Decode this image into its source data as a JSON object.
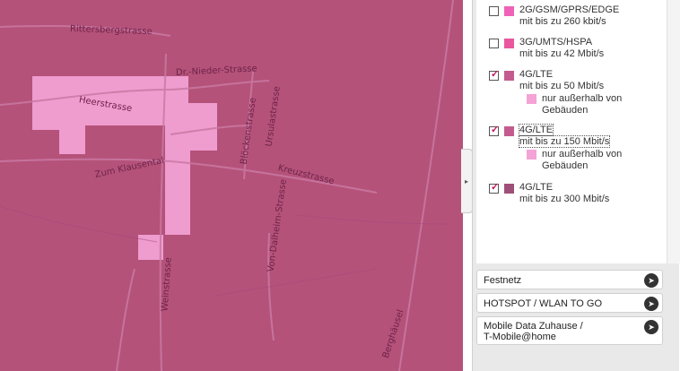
{
  "map": {
    "streets": [
      "Rittersbergstrasse",
      "Dr.-Nieder-Strasse",
      "Heerstrasse",
      "Zum Klausental",
      "Blöckenstrasse",
      "Ursulastrasse",
      "Kreuzstrasse",
      "Von-Dalheim-Strasse",
      "Weinstrasse",
      "Berghäusel"
    ],
    "colors": {
      "coverage_base": "#b5527a",
      "coverage_light": "#f4a3d6",
      "roads": "#c979a3"
    }
  },
  "toggle_icon": "▸",
  "legend": {
    "items": [
      {
        "name": "2G/GSM/GPRS/EDGE",
        "speed": "mit bis zu 260 kbit/s",
        "checked": false,
        "color": "#f062b7"
      },
      {
        "name": "3G/UMTS/HSPA",
        "speed": "mit bis zu 42 Mbit/s",
        "checked": false,
        "color": "#e9579f"
      },
      {
        "name": "4G/LTE",
        "speed": "mit bis zu 50 Mbit/s",
        "checked": true,
        "color": "#c45b8e",
        "sub": "nur außerhalb von Gebäuden"
      },
      {
        "name": "4G/LTE",
        "speed": "mit bis zu 150 Mbit/s",
        "checked": true,
        "color": "#c45b8e",
        "sub": "nur außerhalb von Gebäuden"
      },
      {
        "name": "4G/LTE",
        "speed": "mit bis zu 300 Mbit/s",
        "checked": true,
        "color": "#9f5078"
      }
    ],
    "sub_color": "#f4a3d6",
    "check_mark": "✓"
  },
  "buttons": [
    {
      "label": "Festnetz",
      "icon": "arrow-right-icon"
    },
    {
      "label": "HOTSPOT / WLAN TO GO",
      "icon": "arrow-right-icon"
    },
    {
      "label": "Mobile Data Zuhause /",
      "label2": "T-Mobile@home",
      "icon": "arrow-right-icon"
    }
  ],
  "arrow_glyph": "➤"
}
